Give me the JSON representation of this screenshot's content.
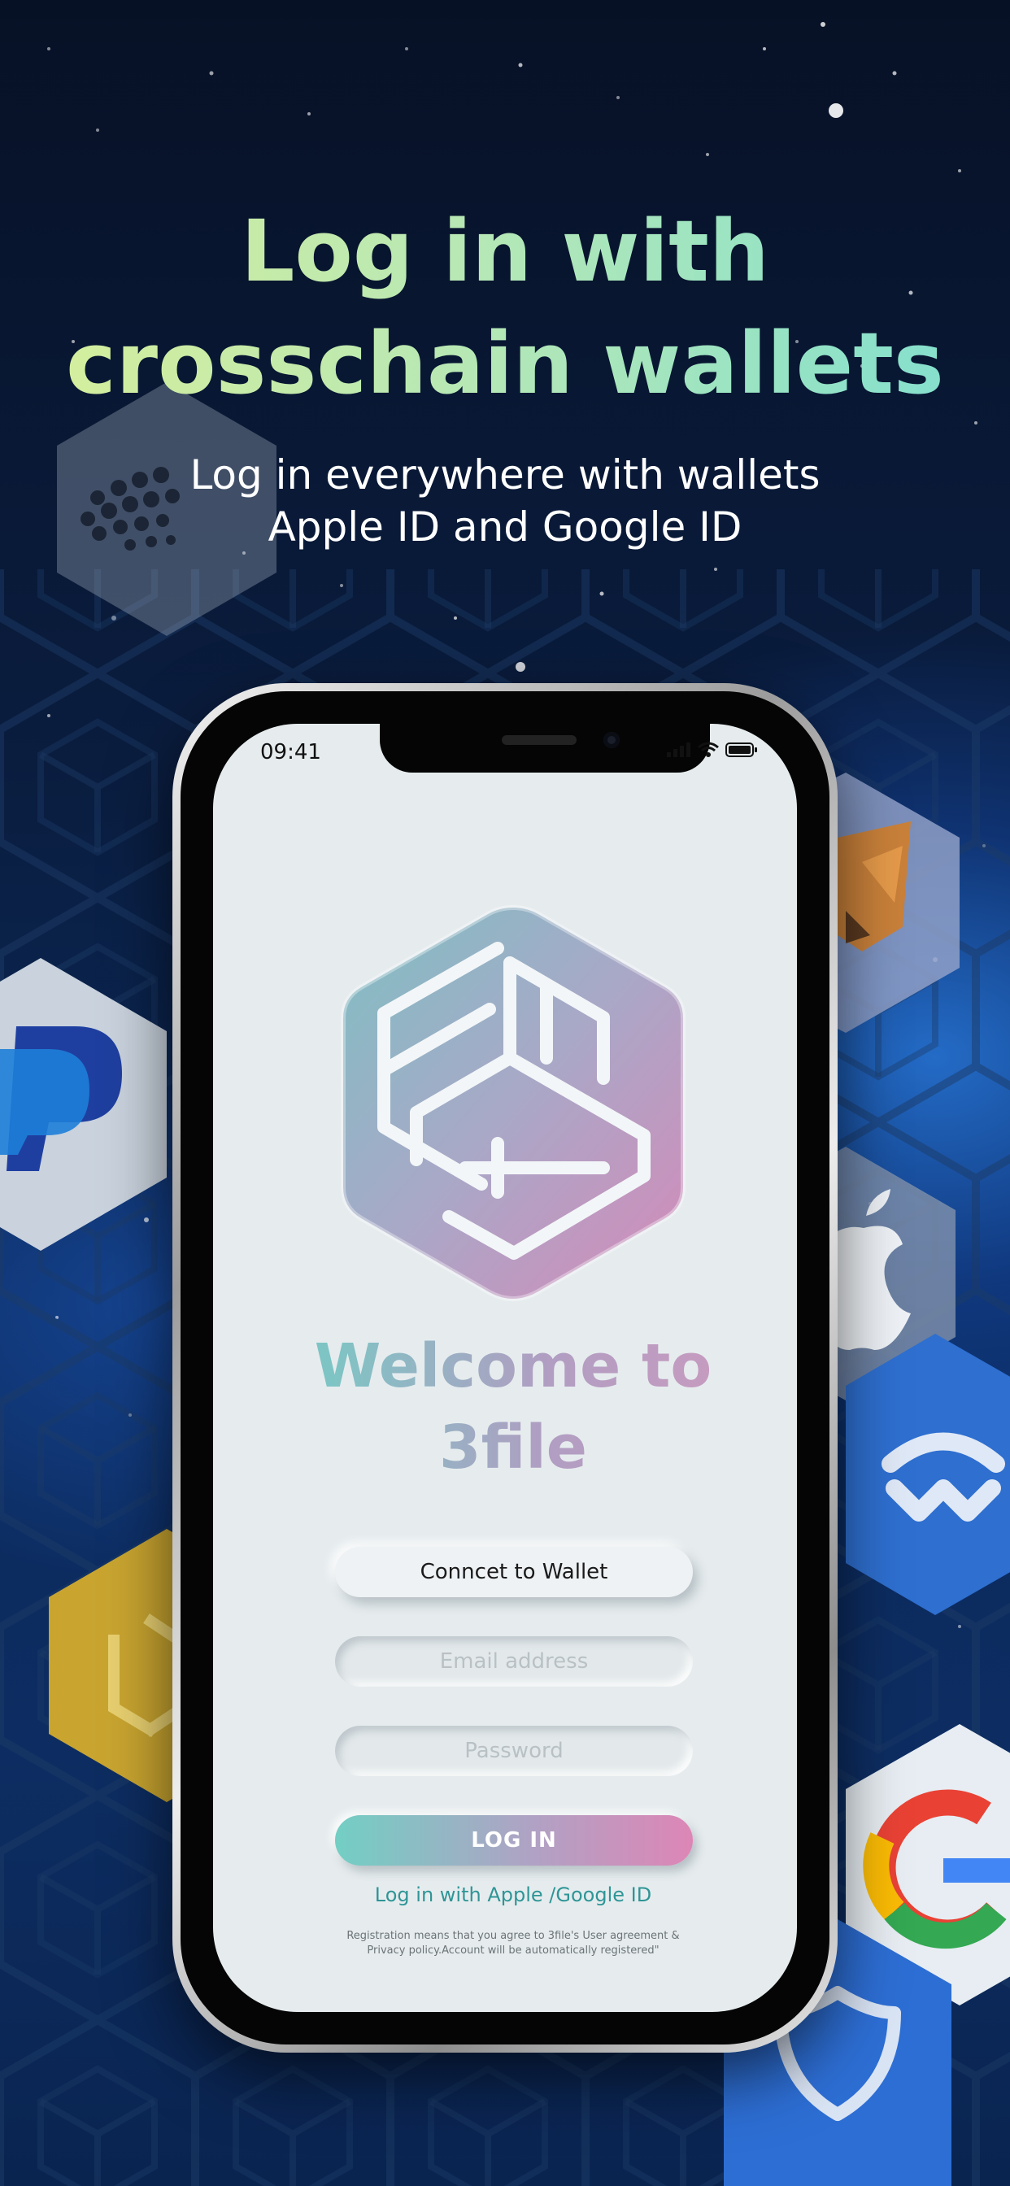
{
  "promo": {
    "headline_line1": "Log in with",
    "headline_line2": "crosschain wallets",
    "subtitle_line1": "Log in everywhere with wallets",
    "subtitle_line2": "Apple ID and Google ID"
  },
  "status_bar": {
    "time": "09:41",
    "icons": [
      "signal-icon",
      "wifi-icon",
      "battery-icon"
    ]
  },
  "app": {
    "logo_icon": "3file-hexagon-logo",
    "welcome_line1": "Welcome to",
    "welcome_line2": "3file",
    "connect_wallet_label": "Conncet to Wallet",
    "email_placeholder": "Email address",
    "password_placeholder": "Password",
    "login_label": "LOG IN",
    "alt_login_link": "Log in with Apple /Google ID",
    "terms_line1": "Registration means that you agree to 3file's User agreement &",
    "terms_line2": "Privacy policy.Account will be automatically registered\""
  },
  "background_icons": [
    "dots-logo-icon",
    "paypal-icon",
    "binance-icon",
    "metamask-fox-icon",
    "apple-icon",
    "walletconnect-icon",
    "google-icon",
    "trust-wallet-shield-icon"
  ],
  "colors": {
    "background_top": "#071126",
    "background_glow": "#2878dc",
    "headline_start": "#d8ef9a",
    "headline_end": "#7fdfd0",
    "screen_bg": "#e6ecee",
    "login_gradient_start": "#72cfc4",
    "login_gradient_end": "#dd86b6",
    "link_color": "#2f9596"
  }
}
